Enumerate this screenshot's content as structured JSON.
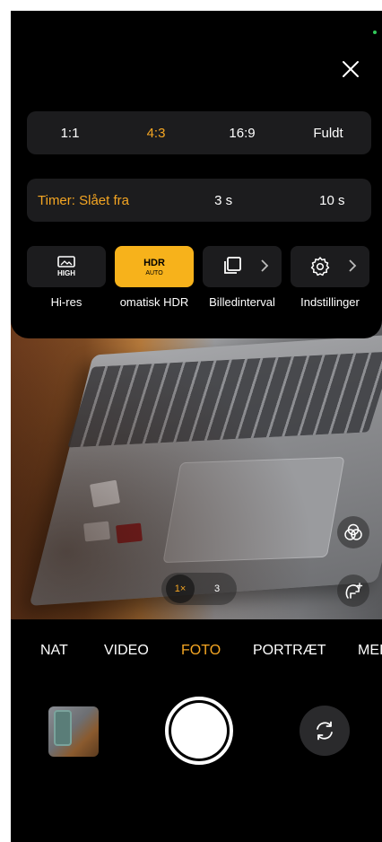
{
  "panel": {
    "aspect_ratios": [
      {
        "label": "1:1",
        "active": false
      },
      {
        "label": "4:3",
        "active": true
      },
      {
        "label": "16:9",
        "active": false
      },
      {
        "label": "Fuldt",
        "active": false
      }
    ],
    "timer": {
      "selected_label": "Timer: Slået fra",
      "options": [
        "3 s",
        "10 s"
      ]
    },
    "tiles": [
      {
        "label": "Hi-res",
        "icon": "hi-res-high-icon",
        "badge": "HIGH"
      },
      {
        "label": "omatisk HDR",
        "icon": "hdr-auto-icon",
        "badge_top": "HDR",
        "badge_bottom": "AUTO",
        "active": true
      },
      {
        "label": "Billedinterval",
        "icon": "burst-stack-icon"
      },
      {
        "label": "Indstillinger",
        "icon": "gear-icon"
      }
    ]
  },
  "viewfinder": {
    "zoom_options": [
      "1×",
      "3"
    ],
    "active_zoom": "1×"
  },
  "modes": {
    "items": [
      "NAT",
      "VIDEO",
      "FOTO",
      "PORTRÆT",
      "MEI"
    ],
    "active": "FOTO"
  },
  "colors": {
    "accent": "#f5a623",
    "hdr_tile": "#f7b21b",
    "tile_bg": "#1c1c1e",
    "background": "#000000"
  }
}
